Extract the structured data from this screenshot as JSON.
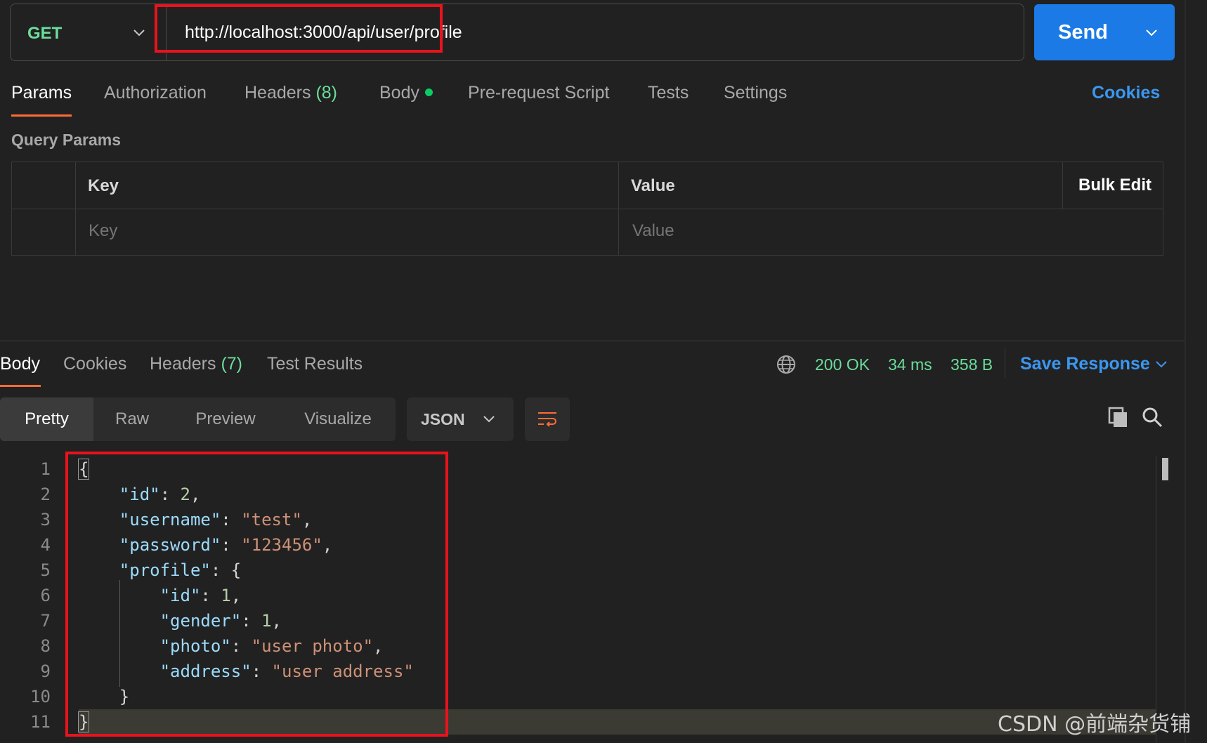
{
  "request": {
    "method": "GET",
    "url": "http://localhost:3000/api/user/profile",
    "send_label": "Send"
  },
  "request_tabs": [
    {
      "label": "Params",
      "active": true
    },
    {
      "label": "Authorization"
    },
    {
      "label": "Headers",
      "count": "(8)"
    },
    {
      "label": "Body",
      "has_dot": true
    },
    {
      "label": "Pre-request Script"
    },
    {
      "label": "Tests"
    },
    {
      "label": "Settings"
    }
  ],
  "cookies_link": "Cookies",
  "query_params": {
    "title": "Query Params",
    "columns": {
      "key": "Key",
      "value": "Value",
      "bulk_edit": "Bulk Edit"
    },
    "placeholders": {
      "key": "Key",
      "value": "Value"
    }
  },
  "response_tabs": [
    {
      "label": "Body",
      "active": true
    },
    {
      "label": "Cookies"
    },
    {
      "label": "Headers",
      "count": "(7)"
    },
    {
      "label": "Test Results"
    }
  ],
  "response_status": {
    "status": "200 OK",
    "time": "34 ms",
    "size": "358 B",
    "save_label": "Save Response"
  },
  "view_modes": [
    "Pretty",
    "Raw",
    "Preview",
    "Visualize"
  ],
  "active_view": "Pretty",
  "format": "JSON",
  "code_lines": [
    {
      "n": "1",
      "tokens": [
        {
          "t": "{",
          "c": "brace-hl"
        }
      ]
    },
    {
      "n": "2",
      "tokens": [
        {
          "t": "    ",
          "c": "p"
        },
        {
          "t": "\"id\"",
          "c": "k"
        },
        {
          "t": ": ",
          "c": "p"
        },
        {
          "t": "2",
          "c": "n"
        },
        {
          "t": ",",
          "c": "p"
        }
      ]
    },
    {
      "n": "3",
      "tokens": [
        {
          "t": "    ",
          "c": "p"
        },
        {
          "t": "\"username\"",
          "c": "k"
        },
        {
          "t": ": ",
          "c": "p"
        },
        {
          "t": "\"test\"",
          "c": "s"
        },
        {
          "t": ",",
          "c": "p"
        }
      ]
    },
    {
      "n": "4",
      "tokens": [
        {
          "t": "    ",
          "c": "p"
        },
        {
          "t": "\"password\"",
          "c": "k"
        },
        {
          "t": ": ",
          "c": "p"
        },
        {
          "t": "\"123456\"",
          "c": "s"
        },
        {
          "t": ",",
          "c": "p"
        }
      ]
    },
    {
      "n": "5",
      "tokens": [
        {
          "t": "    ",
          "c": "p"
        },
        {
          "t": "\"profile\"",
          "c": "k"
        },
        {
          "t": ": {",
          "c": "p"
        }
      ]
    },
    {
      "n": "6",
      "tokens": [
        {
          "t": "        ",
          "c": "p"
        },
        {
          "t": "\"id\"",
          "c": "k"
        },
        {
          "t": ": ",
          "c": "p"
        },
        {
          "t": "1",
          "c": "n"
        },
        {
          "t": ",",
          "c": "p"
        }
      ]
    },
    {
      "n": "7",
      "tokens": [
        {
          "t": "        ",
          "c": "p"
        },
        {
          "t": "\"gender\"",
          "c": "k"
        },
        {
          "t": ": ",
          "c": "p"
        },
        {
          "t": "1",
          "c": "n"
        },
        {
          "t": ",",
          "c": "p"
        }
      ]
    },
    {
      "n": "8",
      "tokens": [
        {
          "t": "        ",
          "c": "p"
        },
        {
          "t": "\"photo\"",
          "c": "k"
        },
        {
          "t": ": ",
          "c": "p"
        },
        {
          "t": "\"user photo\"",
          "c": "s"
        },
        {
          "t": ",",
          "c": "p"
        }
      ]
    },
    {
      "n": "9",
      "tokens": [
        {
          "t": "        ",
          "c": "p"
        },
        {
          "t": "\"address\"",
          "c": "k"
        },
        {
          "t": ": ",
          "c": "p"
        },
        {
          "t": "\"user address\"",
          "c": "s"
        }
      ]
    },
    {
      "n": "10",
      "tokens": [
        {
          "t": "    }",
          "c": "p"
        }
      ]
    },
    {
      "n": "11",
      "tokens": [
        {
          "t": "}",
          "c": "brace-hl"
        }
      ],
      "current": true
    }
  ],
  "watermark": "CSDN @前端杂货铺",
  "colors": {
    "background": "#212121",
    "accent_orange": "#ff6c37",
    "send_blue": "#1b7ae6",
    "link_blue": "#3b97f0",
    "success_green": "#6bdd9a",
    "highlight_red": "#e8131c"
  }
}
